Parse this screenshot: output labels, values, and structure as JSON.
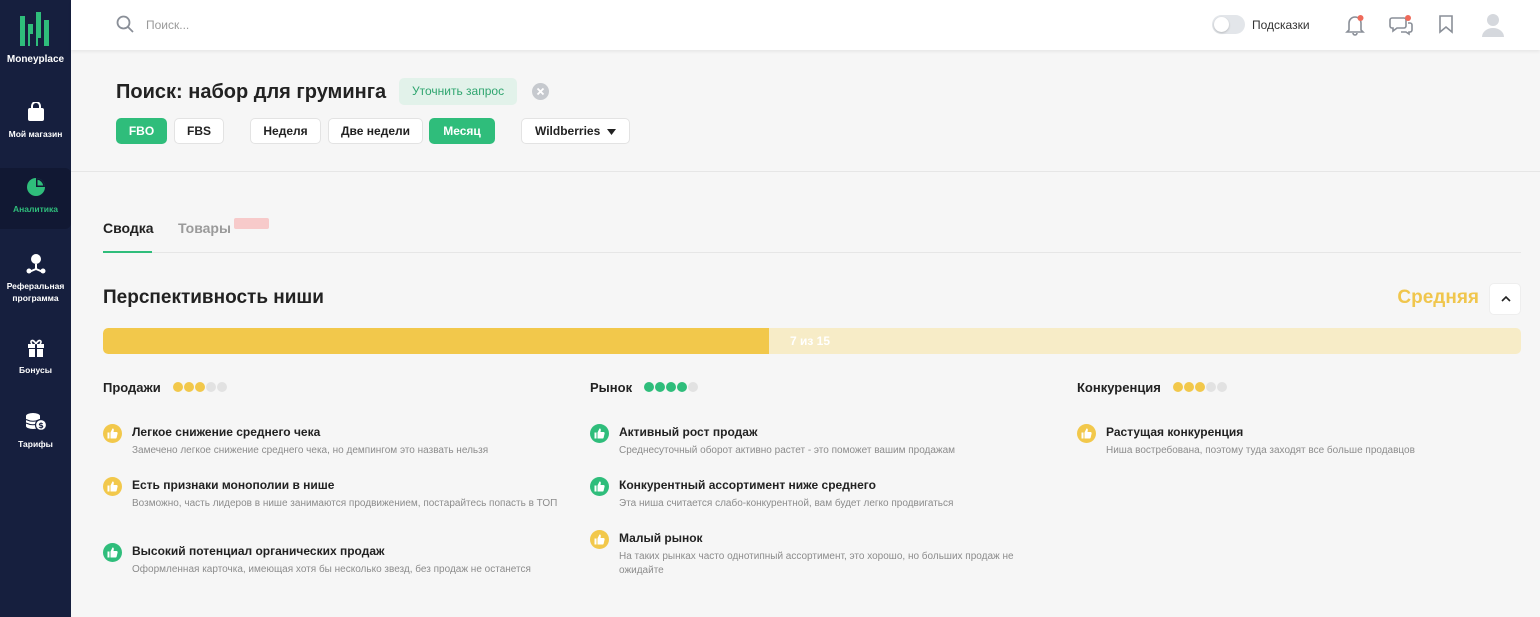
{
  "app": {
    "logo_text": "Moneyplace"
  },
  "colors": {
    "accent_green": "#2fbd7b",
    "accent_yellow": "#f2c84b",
    "sidebar_bg": "#161f3e"
  },
  "sidebar": {
    "items": [
      {
        "label": "Мой магазин",
        "icon": "shopping-bag-icon"
      },
      {
        "label": "Аналитика",
        "icon": "pie-chart-icon",
        "active": true
      },
      {
        "label": "Реферальная программа",
        "icon": "referral-icon"
      },
      {
        "label": "Бонусы",
        "icon": "gift-icon"
      },
      {
        "label": "Тарифы",
        "icon": "coins-icon"
      }
    ]
  },
  "topbar": {
    "search_placeholder": "Поиск...",
    "hints_label": "Подсказки",
    "hints_on": false,
    "icons": [
      "notifications-bell-icon",
      "chat-icon",
      "bookmark-icon",
      "user-avatar-icon"
    ]
  },
  "header": {
    "title": "Поиск: набор для груминга",
    "refine_label": "Уточнить запрос",
    "chips": {
      "fbo": "FBO",
      "fbs": "FBS",
      "week": "Неделя",
      "two_weeks": "Две недели",
      "month": "Месяц",
      "marketplace": "Wildberries"
    }
  },
  "tabs": [
    {
      "label": "Сводка",
      "active": true
    },
    {
      "label": "Товары",
      "active": false
    }
  ],
  "niche": {
    "title": "Перспективность ниши",
    "level": "Средняя",
    "progress_label": "7 из 15",
    "progress_value": 7,
    "progress_max": 15,
    "progress_fill_fraction": 0.47
  },
  "columns": [
    {
      "title": "Продажи",
      "rating": 3,
      "rating_max": 5,
      "color": "#f2c84b",
      "items": [
        {
          "title": "Легкое снижение среднего чека",
          "desc": "Замечено легкое снижение среднего чека, но демпингом это назвать нельзя",
          "tone": "yellow"
        },
        {
          "title": "Есть признаки монополии в нише",
          "desc": "Возможно, часть лидеров в нише занимаются продвижением, постарайтесь попасть в ТОП",
          "tone": "yellow"
        },
        {
          "title": "Высокий потенциал органических продаж",
          "desc": "Оформленная карточка, имеющая хотя бы несколько звезд, без продаж не останется",
          "tone": "green"
        }
      ]
    },
    {
      "title": "Рынок",
      "rating": 4,
      "rating_max": 5,
      "color": "#2fbd7b",
      "items": [
        {
          "title": "Активный рост продаж",
          "desc": "Среднесуточный оборот активно растет - это поможет вашим продажам",
          "tone": "green"
        },
        {
          "title": "Конкурентный ассортимент ниже среднего",
          "desc": "Эта ниша считается слабо-конкурентной, вам будет легко продвигаться",
          "tone": "green"
        },
        {
          "title": "Малый рынок",
          "desc": "На таких рынках часто однотипный ассортимент, это хорошо, но больших продаж не ожидайте",
          "tone": "yellow"
        }
      ]
    },
    {
      "title": "Конкуренция",
      "rating": 3,
      "rating_max": 5,
      "color": "#f2c84b",
      "items": [
        {
          "title": "Растущая конкуренция",
          "desc": "Ниша востребована, поэтому туда заходят все больше продавцов",
          "tone": "yellow"
        }
      ]
    }
  ]
}
